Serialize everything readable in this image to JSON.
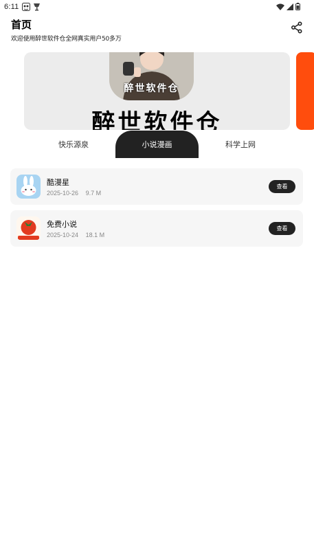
{
  "status_bar": {
    "time": "6:11"
  },
  "header": {
    "title": "首页",
    "subtitle": "欢迎使用醉世软件仓全网真实用户50多万",
    "share_icon": "share-icon"
  },
  "banner": {
    "avatar_overlay_text": "醉世软件仓",
    "headline": "醉世软件仓",
    "next_slide_color": "#ff4d0d"
  },
  "tabs": [
    {
      "label": "快乐源泉",
      "active": false
    },
    {
      "label": "小说漫画",
      "active": true
    },
    {
      "label": "科学上网",
      "active": false
    }
  ],
  "apps": [
    {
      "name": "酷漫星",
      "date": "2025-10-26",
      "size": "9.7 M",
      "icon": "rabbit-icon",
      "button": "查看"
    },
    {
      "name": "免费小说",
      "date": "2025-10-24",
      "size": "18.1 M",
      "icon": "tomato-icon",
      "icon_text": "番茄小说",
      "button": "查看"
    }
  ]
}
